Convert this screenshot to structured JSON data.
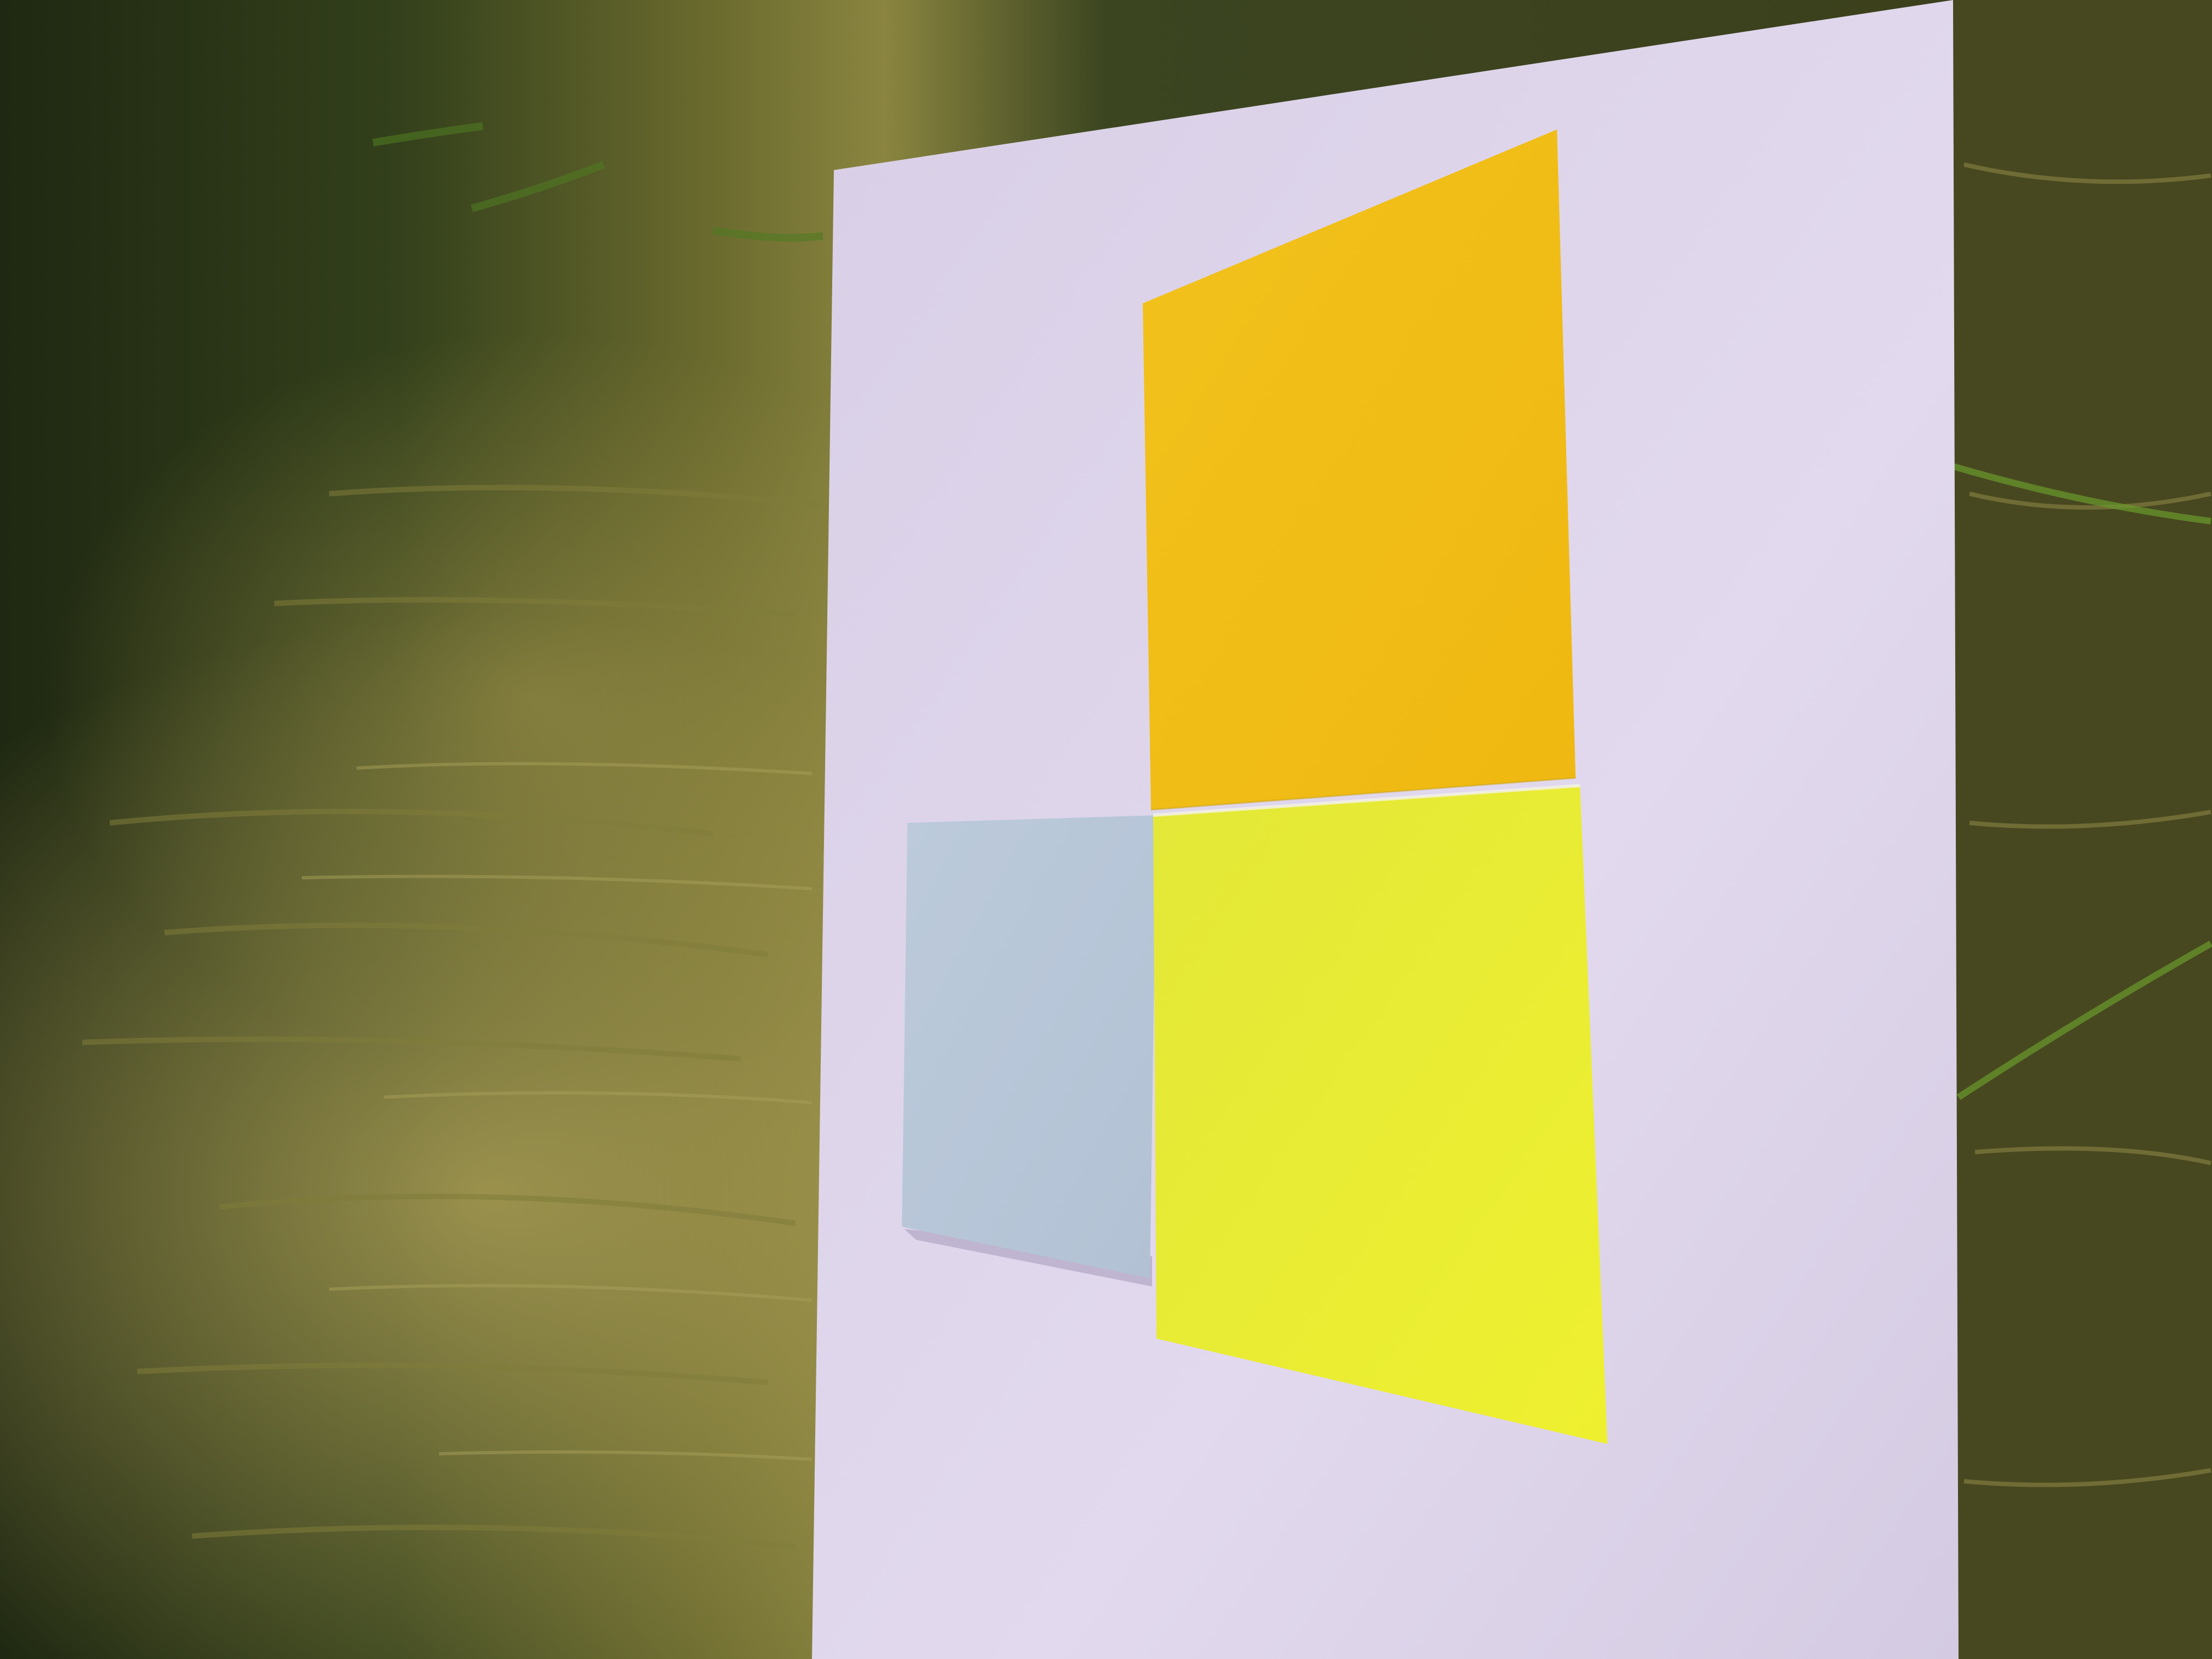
{
  "scene": {
    "description_colors": {
      "grass_dark": "#2b3517",
      "grass_mid": "#5f6a2a",
      "grass_light": "#a39a4f",
      "paper": "#dcd3e8",
      "note_orange": "#f0bf1a",
      "note_yellow": "#e6ea34",
      "note_blue": "#b9c8d9"
    },
    "objects": [
      {
        "name": "white-paper-sheet"
      },
      {
        "name": "orange-sticky-note"
      },
      {
        "name": "yellow-sticky-note"
      },
      {
        "name": "light-blue-sticky-note"
      }
    ]
  }
}
